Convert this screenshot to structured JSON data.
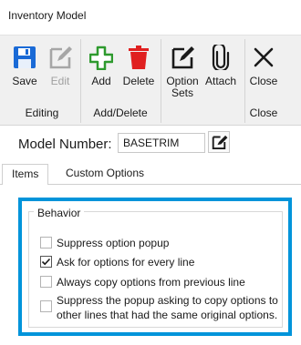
{
  "window": {
    "title": "Inventory Model"
  },
  "ribbon": {
    "buttons": {
      "save": {
        "label": "Save"
      },
      "edit": {
        "label": "Edit"
      },
      "add": {
        "label": "Add"
      },
      "delete": {
        "label": "Delete"
      },
      "option_sets": {
        "label_line1": "Option",
        "label_line2": "Sets"
      },
      "attach": {
        "label": "Attach"
      },
      "close": {
        "label": "Close"
      }
    },
    "groups": {
      "editing": "Editing",
      "add_delete": "Add/Delete",
      "close": "Close"
    }
  },
  "model": {
    "label": "Model Number:",
    "value": "BASETRIM"
  },
  "tabs": [
    {
      "label": "Items",
      "active": true
    },
    {
      "label": "Custom Options",
      "active": false
    }
  ],
  "behavior": {
    "legend": "Behavior",
    "options": [
      {
        "label": "Suppress option popup",
        "checked": false
      },
      {
        "label": "Ask for options for every line",
        "checked": true
      },
      {
        "label": "Always copy options from previous line",
        "checked": false
      },
      {
        "label_line1": "Suppress the popup asking to copy options to",
        "label_line2": "other lines that had the same original options.",
        "checked": false
      }
    ]
  },
  "colors": {
    "save_icon": "#1a6ad6",
    "add_icon": "#2e9a2e",
    "delete_icon": "#e02020",
    "highlight_border": "#0094da"
  }
}
